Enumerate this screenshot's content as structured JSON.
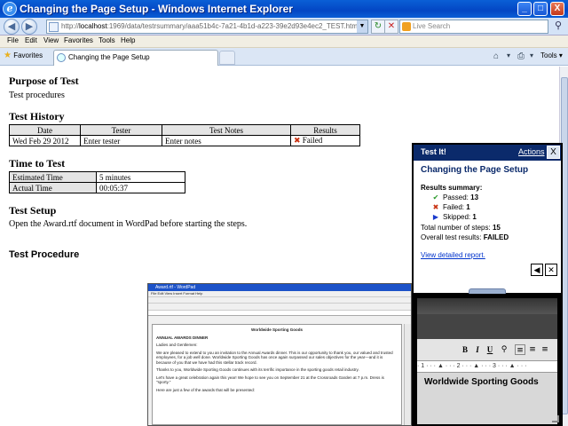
{
  "window": {
    "title": "Changing the Page Setup - Windows Internet Explorer",
    "minimize": "_",
    "maximize": "□",
    "close": "X"
  },
  "address": {
    "url_prefix": "http://",
    "url_host": "localhost",
    "url_rest": ":1969/data/testrsummary/aaa51b4c-7a21-4b1d-a223-39e2d93e4ec2_TEST.html"
  },
  "search": {
    "placeholder": "Live Search"
  },
  "menu": [
    "File",
    "Edit",
    "View",
    "Favorites",
    "Tools",
    "Help"
  ],
  "tabs": {
    "favorites": "Favorites",
    "active_tab": "Changing the Page Setup",
    "tools": "Tools"
  },
  "page": {
    "purpose_heading": "Purpose of Test",
    "purpose_text": "Test procedures",
    "history_heading": "Test History",
    "history_columns": [
      "Date",
      "Tester",
      "Test Notes",
      "Results"
    ],
    "history_rows": [
      {
        "date": "Wed Feb 29 2012",
        "tester": "Enter tester",
        "notes": "Enter notes",
        "result": "Failed"
      }
    ],
    "time_heading": "Time to Test",
    "estimated_label": "Estimated Time",
    "estimated_value": "5 minutes",
    "actual_label": "Actual Time",
    "actual_value": "00:05:37",
    "setup_heading": "Test Setup",
    "setup_text": "Open the Award.rtf document in WordPad before starting the steps.",
    "procedure_heading": "Test Procedure"
  },
  "wordpad_thumb": {
    "title": "Award.rtf - WordPad",
    "menu": "File  Edit  View  Insert  Format  Help",
    "doc_title": "Worldwide Sporting Goods",
    "heading": "ANNUAL AWARDS DINNER",
    "greeting": "Ladies and Gentlemen:",
    "para1": "We are pleased to extend to you an invitation to the Annual Awards dinner. This is our opportunity to thank you, our valued and trusted employees, for a job well done. Worldwide Sporting Goods has once again surpassed our sales objectives for the year—and it is because of you that we have had this stellar track record.",
    "para2": "Thanks to you, Worldwide Sporting Goods continues with its terrific importance in the sporting goods retail industry.",
    "para3": "Let's have a great celebration again this year! We hope to see you on September 21 at the Crossroads Garden at 7 p.m. Dress is \"sporty.\"",
    "para4": "Here are just a few of the awards that will be presented:"
  },
  "testit": {
    "header": "Test It!",
    "actions": "Actions",
    "close": "X",
    "procedure_name": "Changing the Page Setup",
    "summary_title": "Results summary:",
    "passed_label": "Passed:",
    "passed_count": "13",
    "failed_label": "Failed:",
    "failed_count": "1",
    "skipped_label": "Skipped:",
    "skipped_count": "1",
    "total_steps_label": "Total number of steps:",
    "total_steps": "15",
    "overall_label": "Overall test results:",
    "overall_result": "FAILED",
    "report_link": "View detailed report."
  },
  "zoom_preview": {
    "font_buttons": [
      "B",
      "I",
      "U"
    ],
    "ruler": "· 1 · · · ▲ · · · 2 · · · ▲ · · · 3 · · · ▲ · · ·",
    "doc_text": "Worldwide Sporting Goods"
  },
  "colors": {
    "titlebar": "#0346c4",
    "panel_header": "#0b2a6b",
    "failed": "#c83010",
    "passed": "#2a9a2a",
    "skipped": "#1a3acc"
  },
  "icons": {
    "passed": "check-mark",
    "failed": "red-x",
    "skipped": "blue-right-triangle"
  }
}
